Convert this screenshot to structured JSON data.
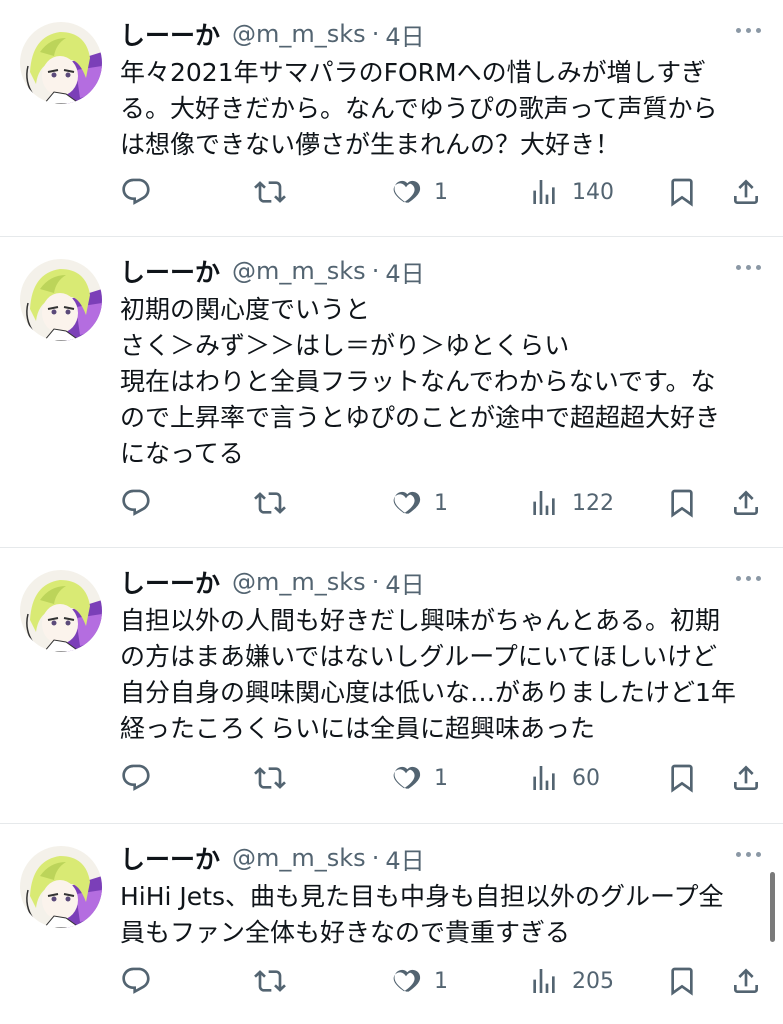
{
  "tweets": [
    {
      "name": "しーーか",
      "handle": "@m_m_sks",
      "dot": "·",
      "time": "4日",
      "lines": [
        "年々2021年サマパラのFORMへの惜しみが増しすぎ",
        "る。大好きだから。なんでゆうぴの歌声って声質から",
        "は想像できない儚さが生まれんの？大好き！"
      ],
      "likes": "1",
      "views": "140"
    },
    {
      "name": "しーーか",
      "handle": "@m_m_sks",
      "dot": "·",
      "time": "4日",
      "lines": [
        "初期の関心度でいうと",
        "さく＞みず＞＞はし＝がり＞ゆとくらい",
        "現在はわりと全員フラットなんでわからないです。な",
        "ので上昇率で言うとゆぴのことが途中で超超超大好き",
        "になってる"
      ],
      "likes": "1",
      "views": "122"
    },
    {
      "name": "しーーか",
      "handle": "@m_m_sks",
      "dot": "·",
      "time": "4日",
      "lines": [
        "自担以外の人間も好きだし興味がちゃんとある。初期",
        "の方はまあ嫌いではないしグループにいてほしいけど",
        "自分自身の興味関心度は低いな…がありましたけど1年",
        "経ったころくらいには全員に超興味あった"
      ],
      "likes": "1",
      "views": "60"
    },
    {
      "name": "しーーか",
      "handle": "@m_m_sks",
      "dot": "·",
      "time": "4日",
      "lines": [
        "HiHi Jets、曲も見た目も中身も自担以外のグループ全",
        "員もファン全体も好きなので貴重すぎる"
      ],
      "likes": "1",
      "views": "205"
    }
  ],
  "icons": {
    "reply": "reply-icon",
    "retweet": "retweet-icon",
    "like": "heart-icon",
    "views": "views-icon",
    "bookmark": "bookmark-icon",
    "share": "share-icon",
    "more": "more-icon"
  },
  "colors": {
    "text": "#0f1419",
    "secondary": "#536471",
    "divider": "#e6e9eb"
  }
}
